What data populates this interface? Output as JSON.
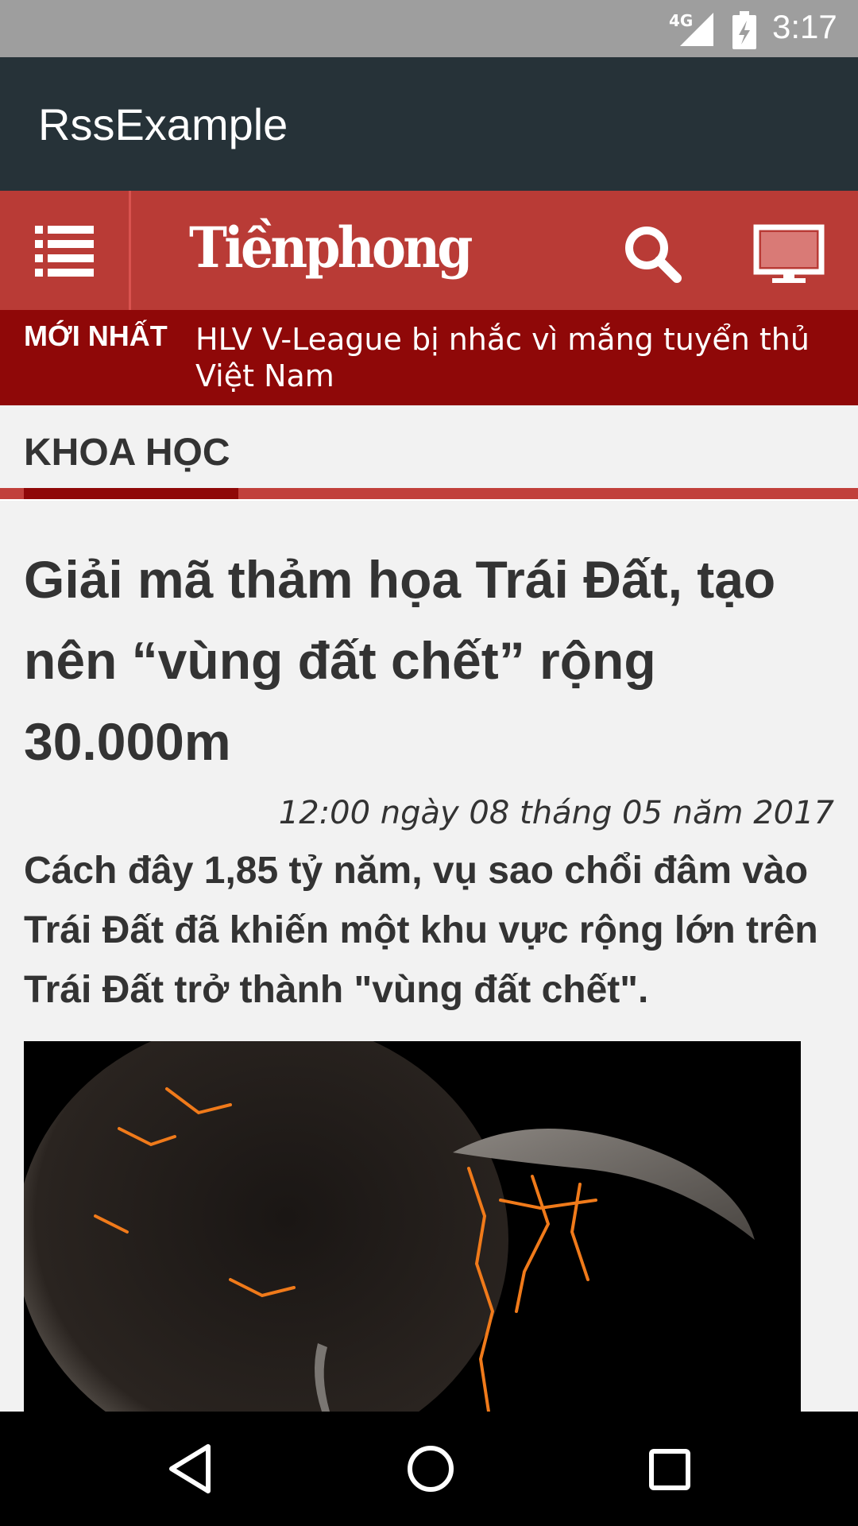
{
  "status_bar": {
    "network": "4G",
    "time": "3:17"
  },
  "app_bar": {
    "title": "RssExample"
  },
  "site_header": {
    "logo_text": "Tiềnphong",
    "icons": [
      "menu-icon",
      "search-icon",
      "tv-icon"
    ]
  },
  "ticker": {
    "label": "MỚI NHẤT",
    "headline": "HLV V-League bị nhắc vì mắng tuyển thủ Việt Nam"
  },
  "section": {
    "title": "KHOA HỌC"
  },
  "article": {
    "title": "Giải mã thảm họa Trái Đất, tạo nên “vùng đất chết” rộng 30.000m",
    "date": "12:00 ngày 08 tháng 05 năm 2017",
    "lead": "Cách đây 1,85 tỷ năm, vụ sao chổi đâm vào Trái Đất đã khiến một khu vực rộng lớn trên Trái Đất trở thành \"vùng đất chết\"."
  },
  "nav_bar": {
    "icons": [
      "back-icon",
      "home-icon",
      "recent-apps-icon"
    ]
  },
  "colors": {
    "app_bar": "#263238",
    "site_header": "#b93b36",
    "ticker": "#8f0808",
    "accent": "#c1403b"
  }
}
